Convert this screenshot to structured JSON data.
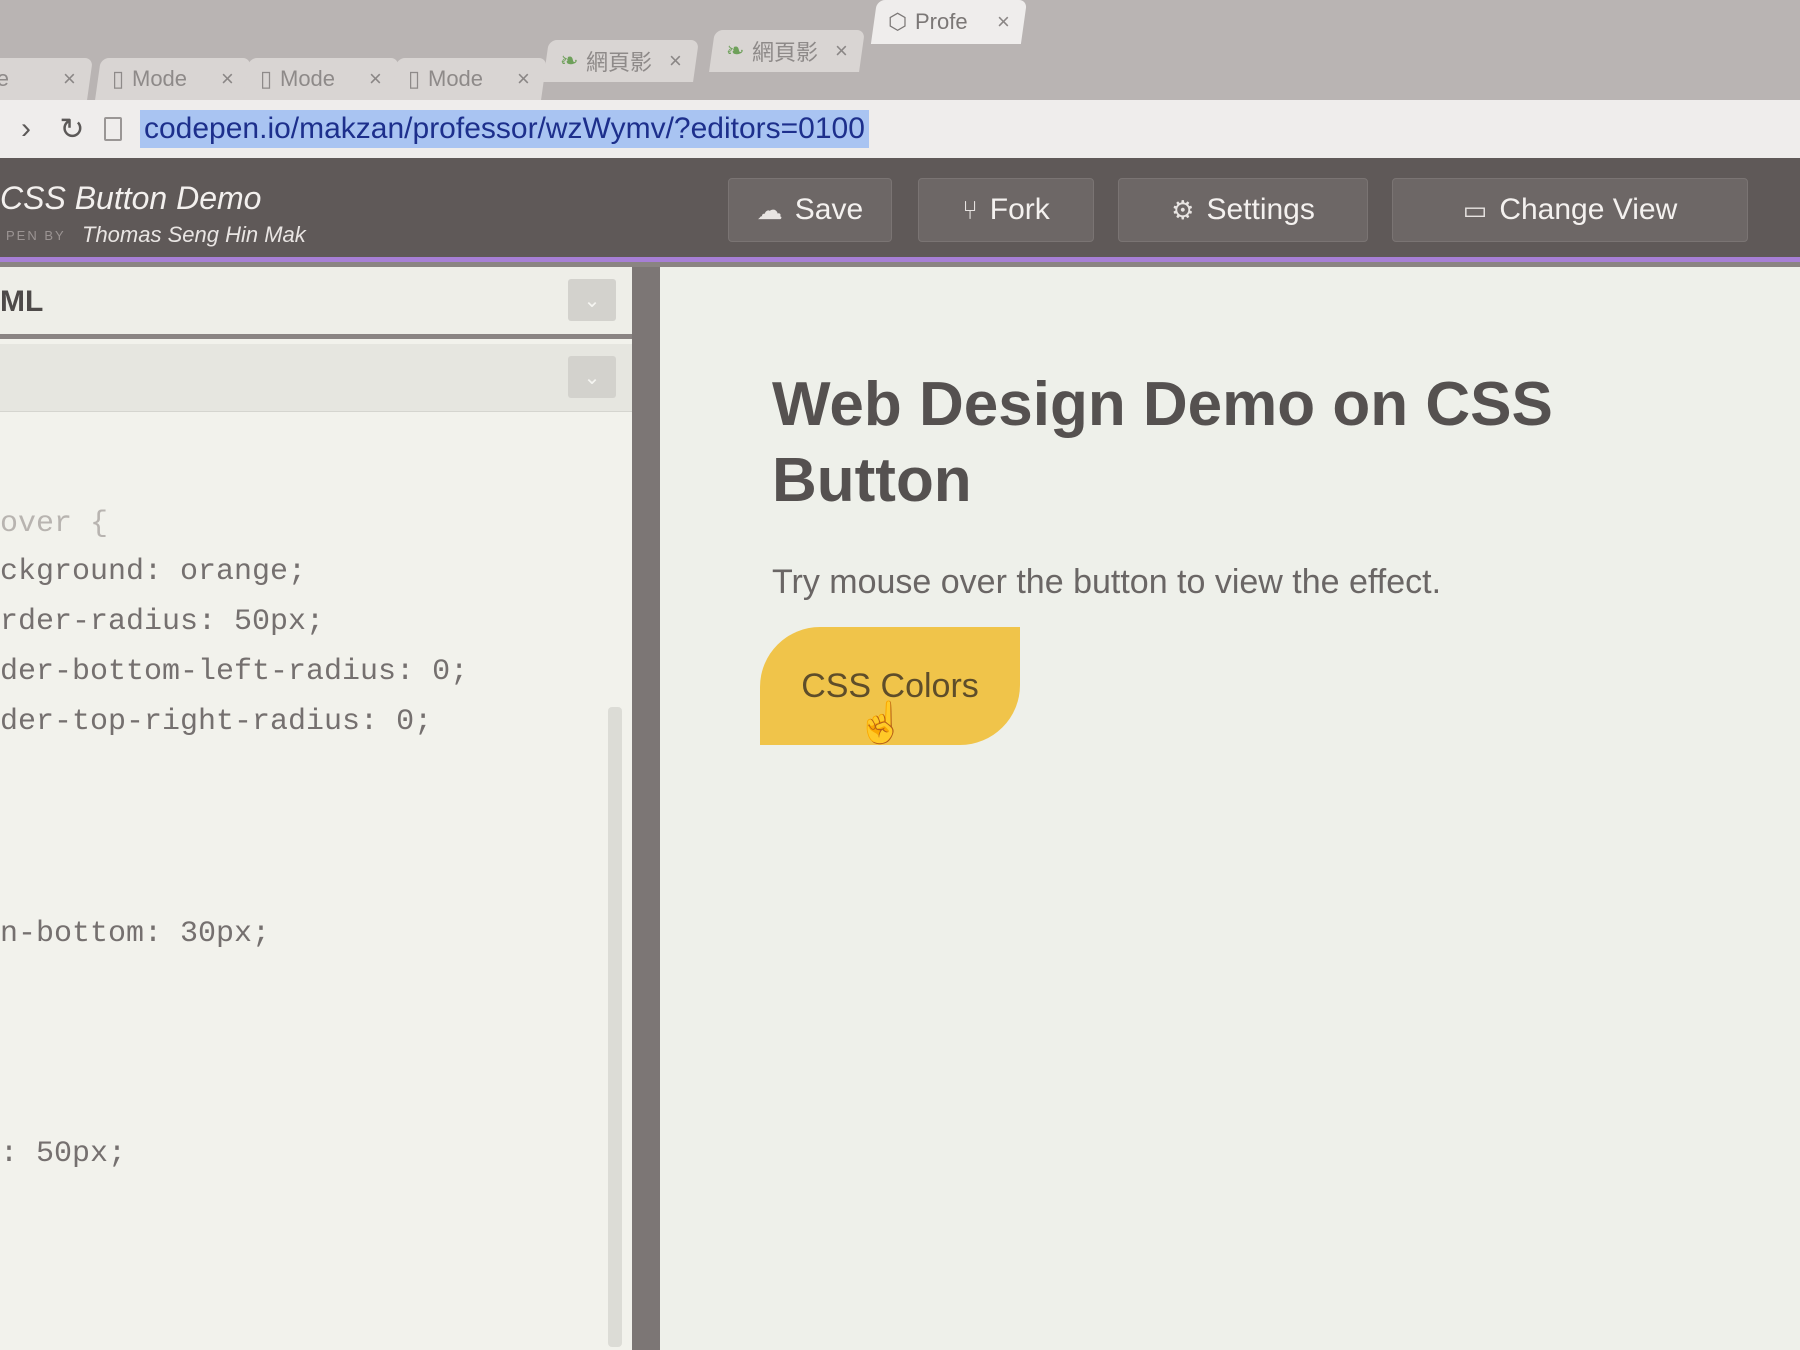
{
  "browser": {
    "tabs": [
      {
        "label": "Mode",
        "close": "×",
        "active": false
      },
      {
        "label": "Mode",
        "close": "×",
        "active": false
      },
      {
        "label": "Mode",
        "close": "×",
        "active": false
      },
      {
        "label": "Mode",
        "close": "×",
        "active": false
      },
      {
        "label": "網頁影",
        "close": "×",
        "active": false
      },
      {
        "label": "網頁影",
        "close": "×",
        "active": false
      },
      {
        "label": "Profe",
        "close": "×",
        "active": true
      }
    ],
    "url": "codepen.io/makzan/professor/wzWymv/?editors=0100"
  },
  "header": {
    "title": "CSS Button Demo",
    "by_label": "PEN BY",
    "author": "Thomas Seng Hin Mak",
    "buttons": {
      "save": "Save",
      "fork": "Fork",
      "settings": "Settings",
      "change_view": "Change View"
    }
  },
  "editor": {
    "html_label": "ML",
    "code_lines": [
      "over {",
      "ckground: orange;",
      "rder-radius: 50px;",
      "der-bottom-left-radius: 0;",
      "der-top-right-radius: 0;",
      "n-bottom: 30px;",
      ": 50px;"
    ]
  },
  "preview": {
    "heading": "Web Design Demo on CSS Button",
    "instruction": "Try mouse over the button to view the effect.",
    "button_label": "CSS Colors"
  },
  "colors": {
    "header_bg": "#5f5958",
    "accent_purple": "#a77fd6",
    "button_yellow": "#f0c44a",
    "url_highlight": "#a9c4f2"
  },
  "icons": [
    "reload-icon",
    "page-icon",
    "cloud-icon",
    "fork-icon",
    "gear-icon",
    "view-icon",
    "hand-cursor-icon",
    "chevron-down-icon"
  ]
}
